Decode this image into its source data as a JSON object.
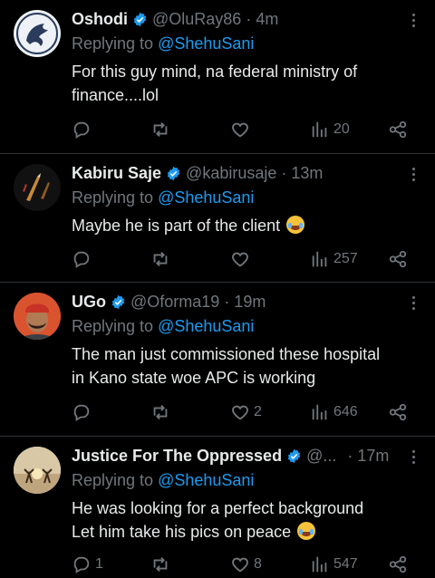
{
  "tweets": [
    {
      "name": "Oshodi",
      "handle": "@OluRay86",
      "time": "· 4m",
      "replying_prefix": "Replying to ",
      "replying_to": "@ShehuSani",
      "lines": [
        "For this guy mind,  na federal ministry of",
        "finance....lol"
      ],
      "counts": {
        "reply": "",
        "retweet": "",
        "like": "",
        "views": "20"
      }
    },
    {
      "name": "Kabiru Saje",
      "handle": "@kabirusaje",
      "time": "· 13m",
      "replying_prefix": "Replying to ",
      "replying_to": "@ShehuSani",
      "lines": [
        "Maybe he is part of the client"
      ],
      "counts": {
        "reply": "",
        "retweet": "",
        "like": "",
        "views": "257"
      }
    },
    {
      "name": "UGo",
      "handle": "@Oforma19",
      "time": "· 19m",
      "replying_prefix": "Replying to ",
      "replying_to": "@ShehuSani",
      "lines": [
        "The man just commissioned these hospital",
        "in Kano state woe APC is working"
      ],
      "counts": {
        "reply": "",
        "retweet": "",
        "like": "2",
        "views": "646"
      }
    },
    {
      "name": "Justice For The Oppressed",
      "handle": "@...",
      "time": "· 17m",
      "replying_prefix": "Replying to ",
      "replying_to": "@ShehuSani",
      "lines": [
        "He was looking for a perfect background",
        "Let him take his pics on peace"
      ],
      "counts": {
        "reply": "1",
        "retweet": "",
        "like": "8",
        "views": "547"
      }
    }
  ],
  "icons": {
    "verified": "verified-badge-icon",
    "more": "more-options-icon",
    "reply": "reply-icon",
    "retweet": "retweet-icon",
    "like": "heart-icon",
    "views": "views-icon",
    "share": "share-icon",
    "emoji": "face-with-tears-of-joy-emoji"
  },
  "colors": {
    "background": "#000000",
    "text": "#e7e9ea",
    "muted": "#71767b",
    "link": "#1d9bf0",
    "divider": "#2f3336"
  }
}
